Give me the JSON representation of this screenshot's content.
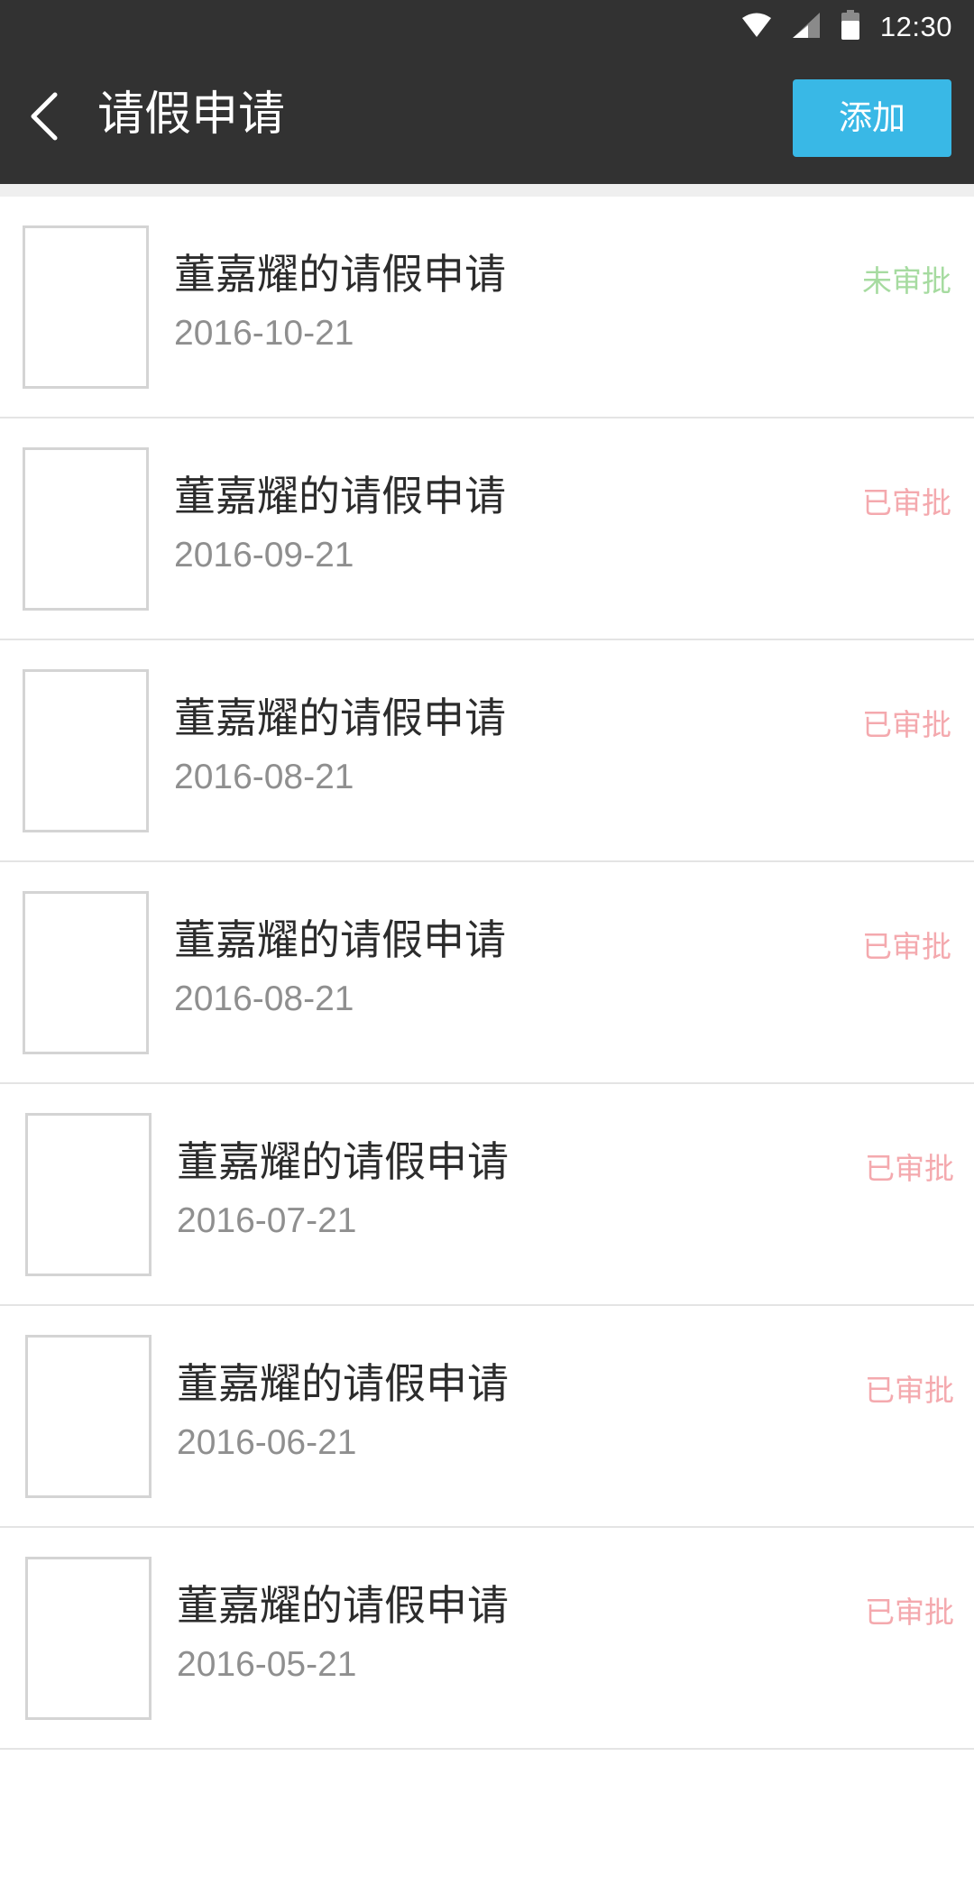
{
  "status_bar": {
    "time": "12:30",
    "icons": [
      "wifi-icon",
      "cellular-signal-icon",
      "battery-icon"
    ]
  },
  "toolbar": {
    "back_icon": "chevron-left-icon",
    "title": "请假申请",
    "add_label": "添加"
  },
  "colors": {
    "app_bar": "#323232",
    "add_button": "#39b8e6",
    "status_pending": "#a6dba0",
    "status_approved": "#f4a9ae"
  },
  "requests": [
    {
      "title": "董嘉耀的请假申请",
      "date": "2016-10-21",
      "status": "未审批",
      "status_color": "#a6dba0"
    },
    {
      "title": "董嘉耀的请假申请",
      "date": "2016-09-21",
      "status": "已审批",
      "status_color": "#f4a9ae"
    },
    {
      "title": "董嘉耀的请假申请",
      "date": "2016-08-21",
      "status": "已审批",
      "status_color": "#f4a9ae"
    },
    {
      "title": "董嘉耀的请假申请",
      "date": "2016-08-21",
      "status": "已审批",
      "status_color": "#f4a9ae"
    },
    {
      "title": "董嘉耀的请假申请",
      "date": "2016-07-21",
      "status": "已审批",
      "status_color": "#f4a9ae"
    },
    {
      "title": "董嘉耀的请假申请",
      "date": "2016-06-21",
      "status": "已审批",
      "status_color": "#f4a9ae"
    },
    {
      "title": "董嘉耀的请假申请",
      "date": "2016-05-21",
      "status": "已审批",
      "status_color": "#f4a9ae"
    }
  ]
}
